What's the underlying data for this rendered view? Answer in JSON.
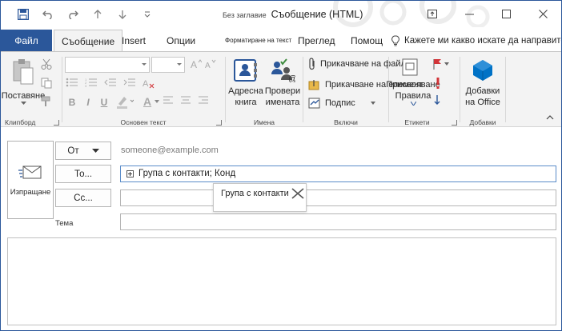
{
  "window": {
    "doc_title": "Без заглавие",
    "title": "Съобщение (HTML)"
  },
  "tabs": {
    "file": "Файл",
    "message": "Съобщение",
    "insert": "Insert",
    "options": "Опции",
    "format_text": "Форматиране на текст",
    "review": "Преглед",
    "help": "Помощ",
    "tell_me": "Кажете ми какво искате да направите"
  },
  "ribbon": {
    "clipboard": {
      "paste": "Поставяне",
      "label": "Клипборд"
    },
    "basic_text": {
      "label": "Основен текст",
      "bold": "B",
      "italic": "I",
      "underline": "U",
      "font_color": "A"
    },
    "names": {
      "address_book_1": "Адресна",
      "address_book_2": "книга",
      "check_names_1": "Провери",
      "check_names_2": "имената",
      "label": "Имена"
    },
    "include": {
      "attach_file": "Прикачване на файл",
      "attach_item": "Прикачване на елемент",
      "signature": "Подпис",
      "label": "Включи"
    },
    "tags": {
      "assign_policy_1": "Присвояване",
      "assign_policy_2": "Правила",
      "label": "Етикети"
    },
    "addins": {
      "office_addins_1": "Добавки",
      "office_addins_2": "на Office",
      "label": "Добавки"
    }
  },
  "compose": {
    "send": "Изпращане",
    "from_label": "От",
    "from_value": "someone@example.com",
    "to_label": "То...",
    "to_value": "Група с контакти; Конд",
    "cc_label": "Cc...",
    "subject_label": "Тема",
    "drag_tooltip": "Група с контакти"
  },
  "colors": {
    "accent": "#2b579a",
    "red": "#d13438",
    "blue_icon": "#0072c6"
  }
}
